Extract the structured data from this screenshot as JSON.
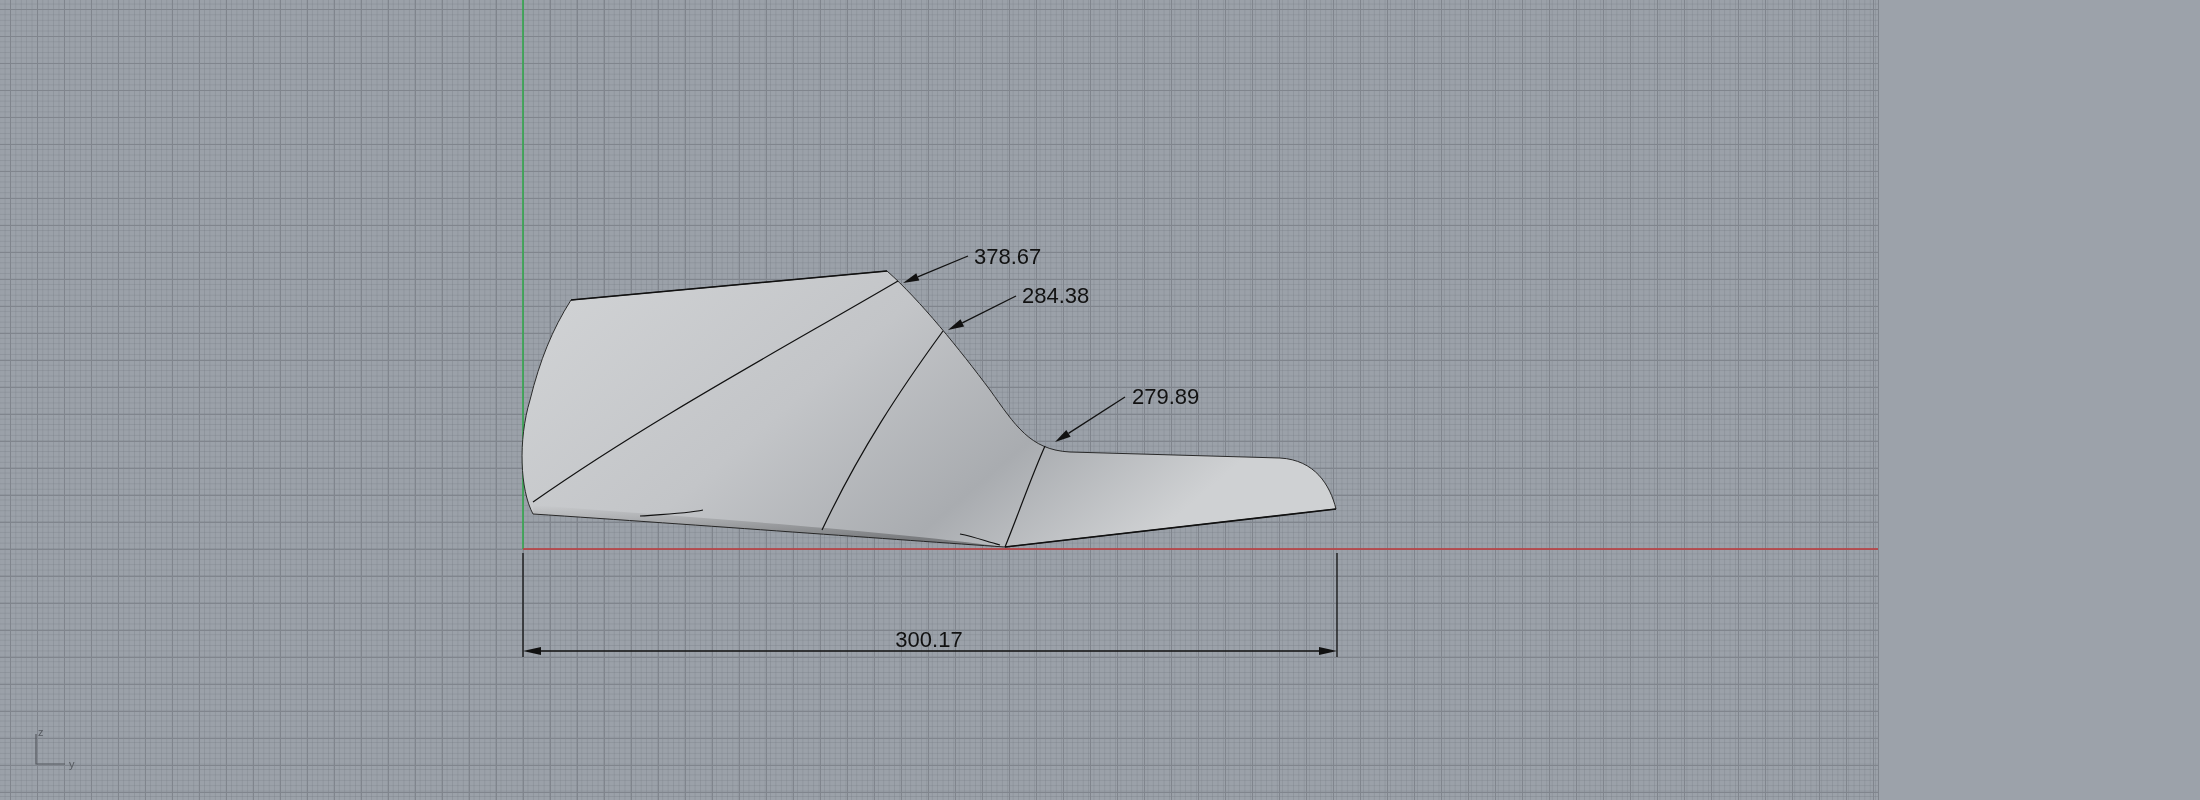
{
  "viewport": {
    "leaders": [
      {
        "text": "378.67"
      },
      {
        "text": "284.38"
      },
      {
        "text": "279.89"
      }
    ],
    "dimension": {
      "text": "300.17"
    },
    "axis_labels": [
      "z",
      "y"
    ]
  }
}
